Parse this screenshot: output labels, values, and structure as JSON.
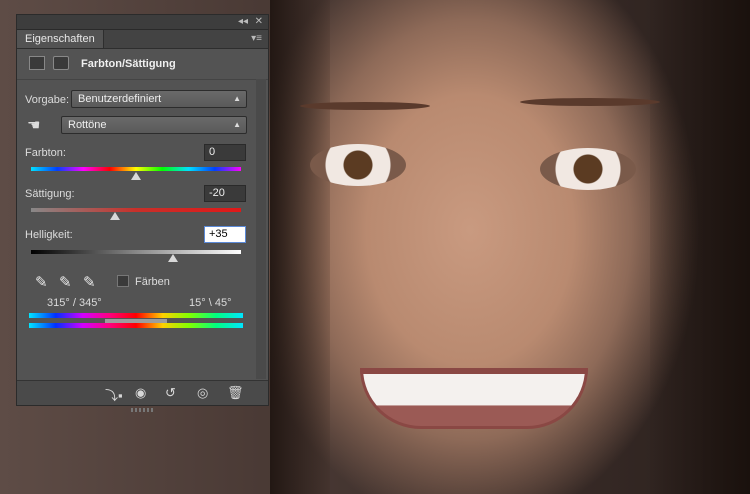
{
  "panel": {
    "tab_label": "Eigenschaften",
    "title": "Farbton/Sättigung",
    "title_icons": [
      "adjustment-layer-icon",
      "mask-icon"
    ],
    "preset": {
      "label": "Vorgabe:",
      "value": "Benutzerdefiniert"
    },
    "range": {
      "value": "Rottöne"
    },
    "hue": {
      "label": "Farbton:",
      "value": "0",
      "level": 0
    },
    "saturation": {
      "label": "Sättigung:",
      "value": "-20",
      "level": -20
    },
    "lightness": {
      "label": "Helligkeit:",
      "value": "+35",
      "level": 35
    },
    "colorize": {
      "label": "Färben",
      "checked": false
    },
    "range_left": {
      "a": "315°",
      "sep": "/",
      "b": "345°"
    },
    "range_right": {
      "a": "15°",
      "sep": "\\",
      "b": "45°"
    },
    "footer_icons": [
      "clip-to-layer-icon",
      "view-previous-icon",
      "reset-icon",
      "visibility-icon",
      "delete-icon"
    ]
  },
  "colors": {
    "panel_bg": "#535353",
    "accent": "#5b8ad8"
  }
}
